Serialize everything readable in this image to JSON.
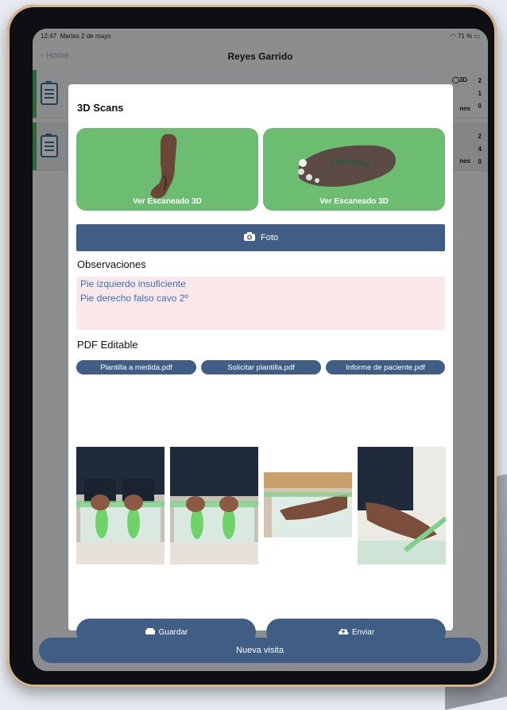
{
  "status_bar": {
    "time": "12:47",
    "date": "Martes 2 de mayo",
    "battery": "71 %"
  },
  "nav": {
    "back_label": "Home",
    "title": "Reyes Garrido"
  },
  "rows": [
    {
      "tag": "3D",
      "n1": "2",
      "n2": "1",
      "suffix": "nes",
      "n3": "0"
    },
    {
      "n1": "2",
      "n2": "4",
      "suffix": "nes",
      "n3": "0"
    }
  ],
  "modal": {
    "title": "3D Scans",
    "scan_cards": [
      {
        "label": "Ver Escaneado 3D"
      },
      {
        "label": "Ver Escaneado 3D"
      }
    ],
    "foto_label": "Foto",
    "observaciones_title": "Observaciones",
    "observaciones_lines": [
      "Pie izquierdo insuficiente",
      "Pie derecho falso cavo 2º"
    ],
    "pdf_title": "PDF Editable",
    "pdf_buttons": [
      "Plantilla a medida.pdf",
      "Solicitar plantilla.pdf",
      "Informe de paciente.pdf"
    ],
    "guardar_label": "Guardar",
    "enviar_label": "Enviar"
  },
  "footer": {
    "nueva_visita": "Nueva visita"
  },
  "colors": {
    "accent_blue": "#3f5d85",
    "scan_green": "#6cbc72",
    "obs_bg": "#fbe8ea",
    "obs_text": "#3b6fb5"
  }
}
